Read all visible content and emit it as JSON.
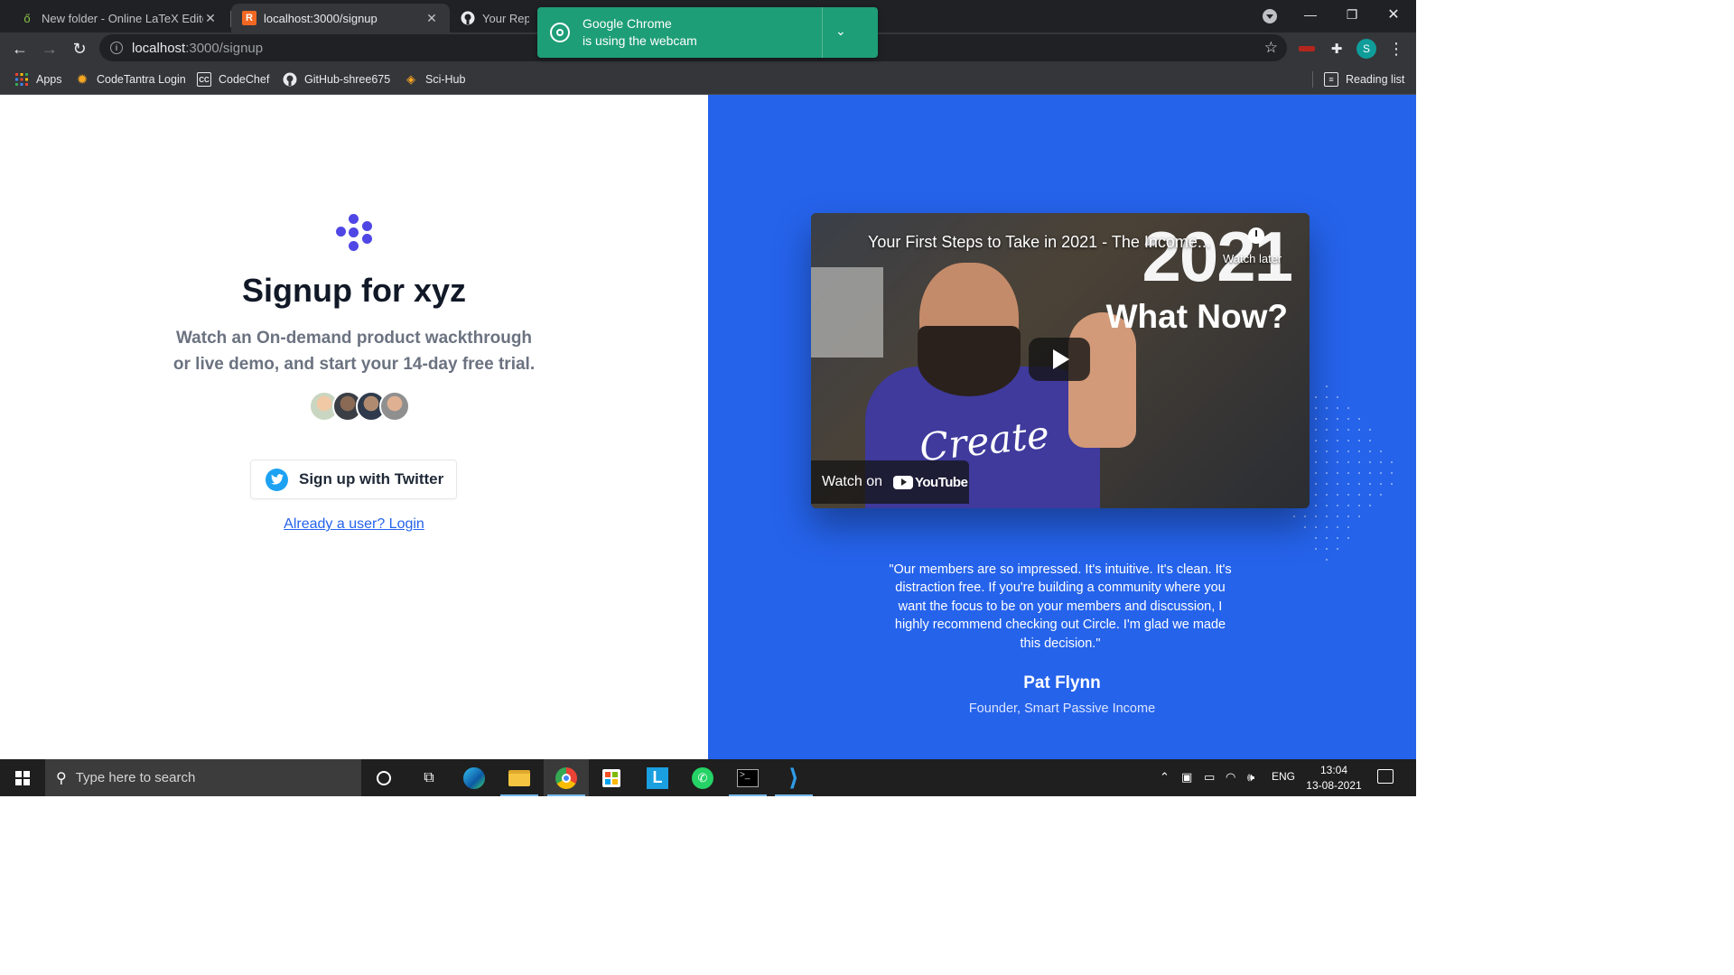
{
  "browser": {
    "tabs": [
      {
        "title": "New folder - Online LaTeX Editor",
        "icon": "overleaf-icon",
        "active": false
      },
      {
        "title": "localhost:3000/signup",
        "icon": "react-icon",
        "active": true
      },
      {
        "title": "Your Repositories",
        "icon": "github-icon",
        "active": false
      }
    ],
    "close_glyph": "✕",
    "new_tab_glyph": "+",
    "url_host": "localhost",
    "url_path": ":3000/signup",
    "profile_initial": "S",
    "reading_list_label": "Reading list"
  },
  "webcam_notification": {
    "line1": "Google Chrome",
    "line2": "is using the webcam",
    "color": "#1e9e76"
  },
  "bookmarks": [
    {
      "label": "Apps",
      "icon": "apps-grid-icon"
    },
    {
      "label": "CodeTantra Login",
      "icon": "codetantra-icon"
    },
    {
      "label": "CodeChef",
      "icon": "codechef-icon"
    },
    {
      "label": "GitHub-shree675",
      "icon": "github-icon"
    },
    {
      "label": "Sci-Hub",
      "icon": "scihub-icon"
    }
  ],
  "signup": {
    "heading": "Signup for xyz",
    "subtext_line1": "Watch an On-demand product wackthrough",
    "subtext_line2": "or live demo, and start your 14-day free trial.",
    "twitter_button": "Sign up with Twitter",
    "login_link": "Already a user? Login",
    "accent_color": "#4f46e5"
  },
  "video": {
    "title": "Your First Steps to Take in 2021 - The Income...",
    "overlay_year": "2021",
    "overlay_subtitle": "What Now?",
    "shirt_text": "Create",
    "watch_later": "Watch later",
    "watch_on": "Watch on",
    "youtube_word": "YouTube"
  },
  "testimonial": {
    "quote": "\"Our members are so impressed. It's intuitive. It's clean. It's distraction free. If you're building a community where you want the focus to be on your members and discussion, I highly recommend checking out Circle. I'm glad we made this decision.\"",
    "author": "Pat Flynn",
    "role": "Founder, Smart Passive Income",
    "panel_color": "#2563eb"
  },
  "taskbar": {
    "search_placeholder": "Type here to search",
    "language": "ENG",
    "time": "13:04",
    "date": "13-08-2021"
  }
}
